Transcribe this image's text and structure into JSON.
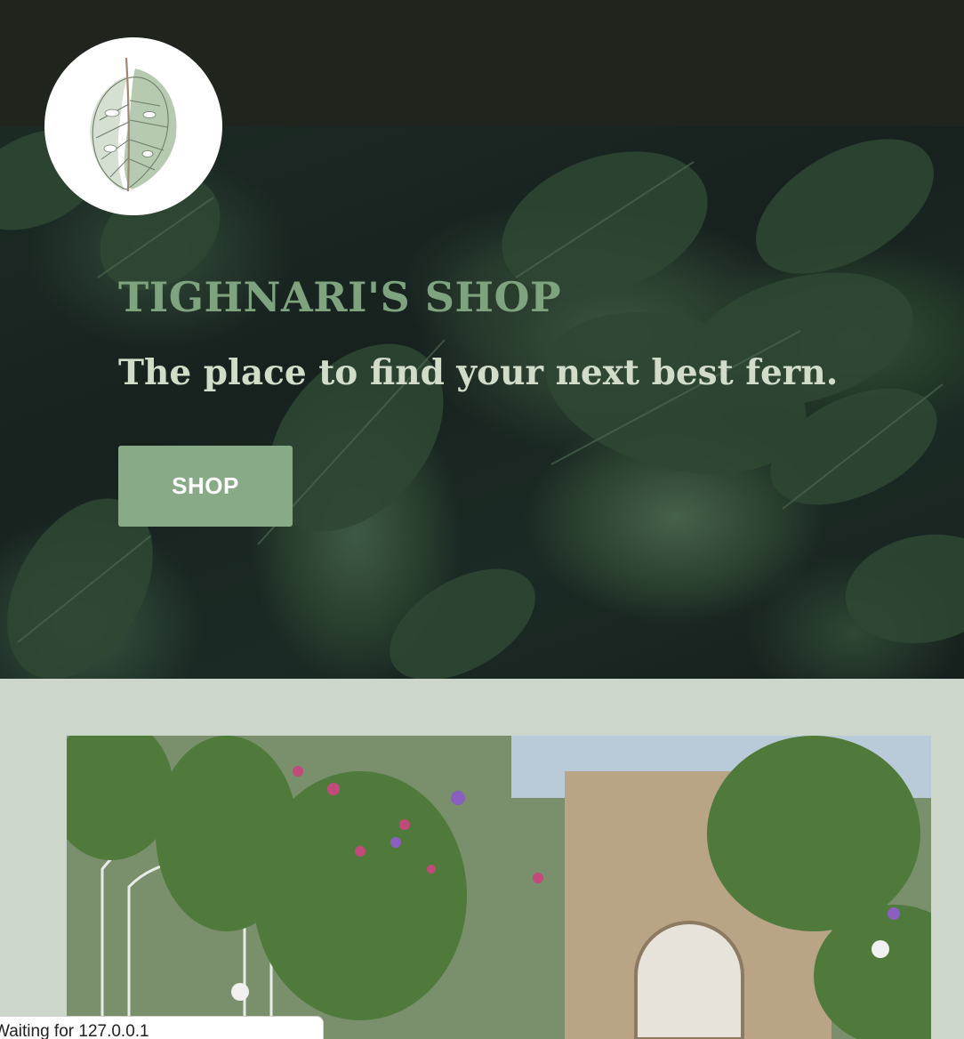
{
  "header": {
    "logo_icon": "monstera-leaf-icon"
  },
  "hero": {
    "title": "TIGHNARI'S SHOP",
    "subtitle": "The place to find your next best fern.",
    "shop_button_label": "SHOP",
    "background": "dark leaves with raindrops photo"
  },
  "gallery": {
    "image": "conservatory with orchids and palms photo"
  },
  "browser": {
    "status_text": "Waiting for 127.0.0.1"
  },
  "colors": {
    "topbar": "#1f241d",
    "title": "#7fa27f",
    "subtitle": "#d1dcc9",
    "button": "#89aa86",
    "section_bg": "#cdd6ca"
  }
}
